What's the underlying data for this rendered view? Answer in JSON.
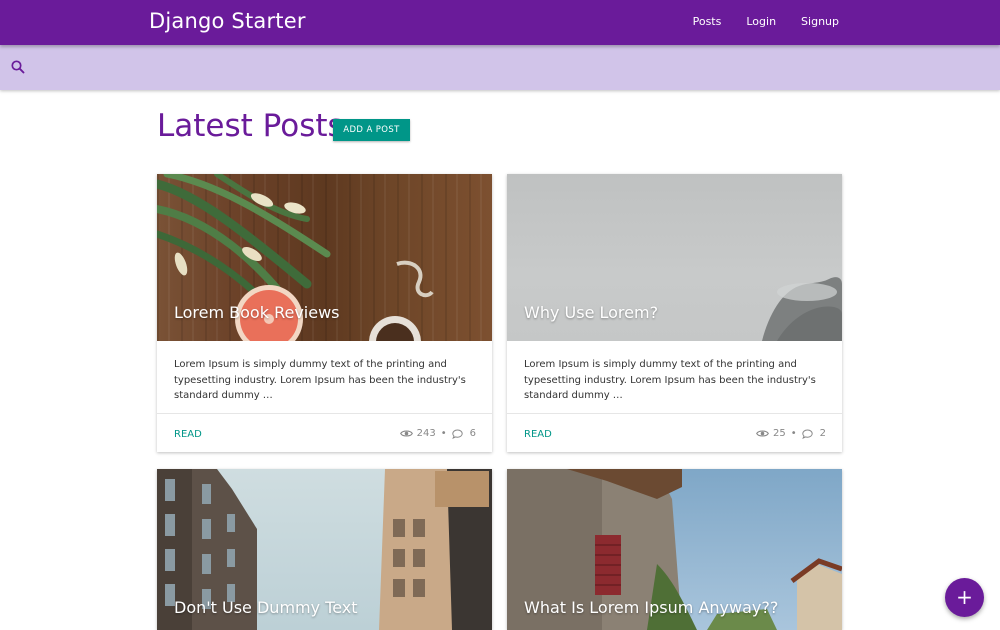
{
  "app": {
    "brand": "Django Starter"
  },
  "nav": {
    "items": [
      {
        "label": "Posts"
      },
      {
        "label": "Login"
      },
      {
        "label": "Signup"
      }
    ]
  },
  "search": {
    "icon": "search-icon"
  },
  "header": {
    "title": "Latest Posts",
    "add_button": "ADD A POST"
  },
  "colors": {
    "primary": "#6a1b9a",
    "search_bar": "#d1c4e9",
    "accent": "#009688"
  },
  "posts": [
    {
      "title": "Lorem Book Reviews",
      "excerpt": "Lorem Ipsum is simply dummy text of the printing and typesetting industry. Lorem Ipsum has been the industry's standard dummy …",
      "action": "READ",
      "views": "243",
      "comments": "6"
    },
    {
      "title": "Why Use Lorem?",
      "excerpt": "Lorem Ipsum is simply dummy text of the printing and typesetting industry. Lorem Ipsum has been the industry's standard dummy …",
      "action": "READ",
      "views": "25",
      "comments": "2"
    },
    {
      "title": "Don't Use Dummy Text"
    },
    {
      "title": "What Is Lorem Ipsum Anyway??"
    }
  ],
  "fab": {
    "label": "+"
  }
}
